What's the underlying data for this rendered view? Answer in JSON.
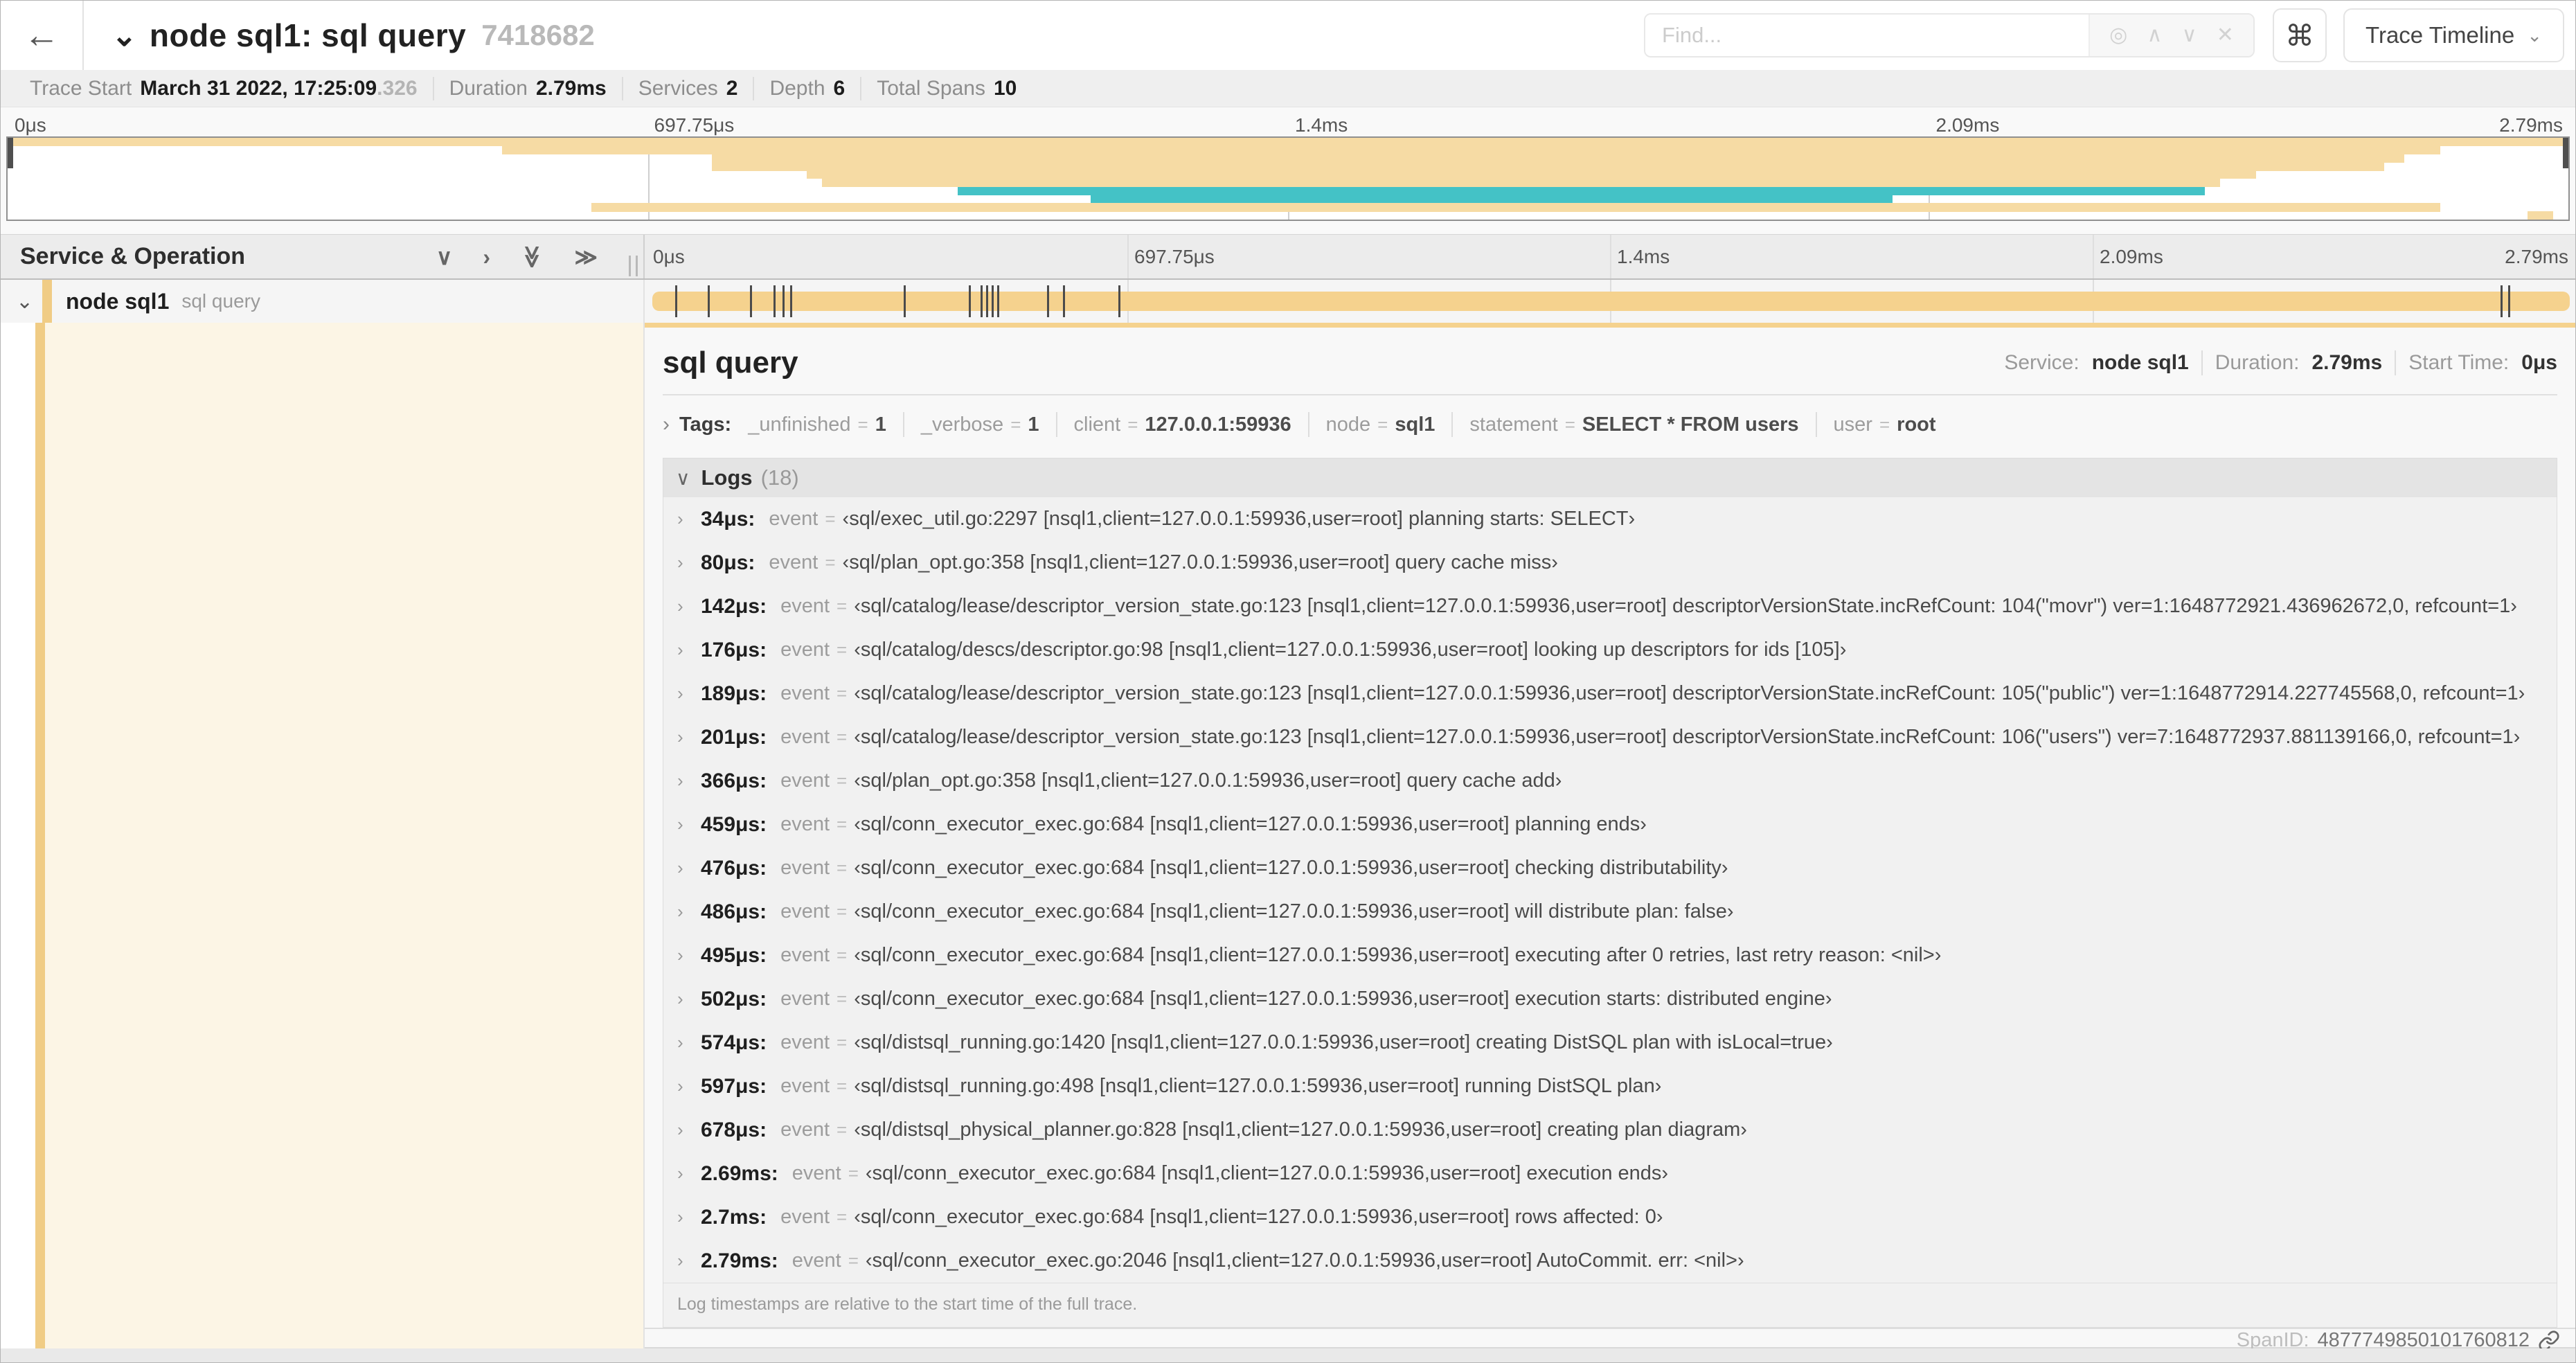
{
  "header": {
    "title": "node sql1: sql query",
    "trace_id": "7418682",
    "find_placeholder": "Find...",
    "command_key": "⌘",
    "view_button": "Trace Timeline",
    "icons": {
      "back": "←",
      "title_collapse": "⌄",
      "locate": "◎",
      "prev": "∧",
      "next": "∨",
      "clear": "✕",
      "view_caret": "⌄"
    }
  },
  "summary": {
    "items": [
      {
        "label": "Trace Start",
        "value": "March 31 2022, 17:25:09",
        "suffix": ".326"
      },
      {
        "label": "Duration",
        "value": "2.79ms",
        "suffix": ""
      },
      {
        "label": "Services",
        "value": "2",
        "suffix": ""
      },
      {
        "label": "Depth",
        "value": "6",
        "suffix": ""
      },
      {
        "label": "Total Spans",
        "value": "10",
        "suffix": ""
      }
    ]
  },
  "timeline": {
    "left_header": "Service & Operation",
    "ticks": [
      "0μs",
      "697.75μs",
      "1.4ms",
      "2.09ms",
      "2.79ms"
    ],
    "icons": {
      "collapse_one": "∨",
      "expand_one": "›",
      "collapse_all": "≫",
      "expand_all": "≫"
    }
  },
  "span": {
    "service": "node sql1",
    "operation": "sql query",
    "chevron": "⌄"
  },
  "detail": {
    "title": "sql query",
    "service_label": "Service:",
    "service_value": "node sql1",
    "duration_label": "Duration:",
    "duration_value": "2.79ms",
    "start_label": "Start Time:",
    "start_value": "0μs",
    "tags_label": "Tags:",
    "eq_sign": "=",
    "tags": [
      {
        "key": "_unfinished",
        "value": "1"
      },
      {
        "key": "_verbose",
        "value": "1"
      },
      {
        "key": "client",
        "value": "127.0.0.1:59936"
      },
      {
        "key": "node",
        "value": "sql1"
      },
      {
        "key": "statement",
        "value": "SELECT * FROM users"
      },
      {
        "key": "user",
        "value": "root"
      }
    ],
    "logs_label": "Logs",
    "logs_count": "(18)",
    "logs": [
      {
        "time": "34μs:",
        "key": "event",
        "value": "‹sql/exec_util.go:2297 [nsql1,client=127.0.0.1:59936,user=root] planning starts: SELECT›"
      },
      {
        "time": "80μs:",
        "key": "event",
        "value": "‹sql/plan_opt.go:358 [nsql1,client=127.0.0.1:59936,user=root] query cache miss›"
      },
      {
        "time": "142μs:",
        "key": "event",
        "value": "‹sql/catalog/lease/descriptor_version_state.go:123 [nsql1,client=127.0.0.1:59936,user=root] descriptorVersionState.incRefCount: 104(\"movr\") ver=1:1648772921.436962672,0, refcount=1›"
      },
      {
        "time": "176μs:",
        "key": "event",
        "value": "‹sql/catalog/descs/descriptor.go:98 [nsql1,client=127.0.0.1:59936,user=root] looking up descriptors for ids [105]›"
      },
      {
        "time": "189μs:",
        "key": "event",
        "value": "‹sql/catalog/lease/descriptor_version_state.go:123 [nsql1,client=127.0.0.1:59936,user=root] descriptorVersionState.incRefCount: 105(\"public\") ver=1:1648772914.227745568,0, refcount=1›"
      },
      {
        "time": "201μs:",
        "key": "event",
        "value": "‹sql/catalog/lease/descriptor_version_state.go:123 [nsql1,client=127.0.0.1:59936,user=root] descriptorVersionState.incRefCount: 106(\"users\") ver=7:1648772937.881139166,0, refcount=1›"
      },
      {
        "time": "366μs:",
        "key": "event",
        "value": "‹sql/plan_opt.go:358 [nsql1,client=127.0.0.1:59936,user=root] query cache add›"
      },
      {
        "time": "459μs:",
        "key": "event",
        "value": "‹sql/conn_executor_exec.go:684 [nsql1,client=127.0.0.1:59936,user=root] planning ends›"
      },
      {
        "time": "476μs:",
        "key": "event",
        "value": "‹sql/conn_executor_exec.go:684 [nsql1,client=127.0.0.1:59936,user=root] checking distributability›"
      },
      {
        "time": "486μs:",
        "key": "event",
        "value": "‹sql/conn_executor_exec.go:684 [nsql1,client=127.0.0.1:59936,user=root] will distribute plan: false›"
      },
      {
        "time": "495μs:",
        "key": "event",
        "value": "‹sql/conn_executor_exec.go:684 [nsql1,client=127.0.0.1:59936,user=root] executing after 0 retries, last retry reason: <nil>›"
      },
      {
        "time": "502μs:",
        "key": "event",
        "value": "‹sql/conn_executor_exec.go:684 [nsql1,client=127.0.0.1:59936,user=root] execution starts: distributed engine›"
      },
      {
        "time": "574μs:",
        "key": "event",
        "value": "‹sql/distsql_running.go:1420 [nsql1,client=127.0.0.1:59936,user=root] creating DistSQL plan with isLocal=true›"
      },
      {
        "time": "597μs:",
        "key": "event",
        "value": "‹sql/distsql_running.go:498 [nsql1,client=127.0.0.1:59936,user=root] running DistSQL plan›"
      },
      {
        "time": "678μs:",
        "key": "event",
        "value": "‹sql/distsql_physical_planner.go:828 [nsql1,client=127.0.0.1:59936,user=root] creating plan diagram›"
      },
      {
        "time": "2.69ms:",
        "key": "event",
        "value": "‹sql/conn_executor_exec.go:684 [nsql1,client=127.0.0.1:59936,user=root] execution ends›"
      },
      {
        "time": "2.7ms:",
        "key": "event",
        "value": "‹sql/conn_executor_exec.go:684 [nsql1,client=127.0.0.1:59936,user=root] rows affected: 0›"
      },
      {
        "time": "2.79ms:",
        "key": "event",
        "value": "‹sql/conn_executor_exec.go:2046 [nsql1,client=127.0.0.1:59936,user=root] AutoCommit. err: <nil>›"
      }
    ],
    "note": "Log timestamps are relative to the start time of the full trace.",
    "span_id_label": "SpanID:",
    "span_id": "4877749850101760812"
  },
  "chart_data": {
    "type": "gantt-minimap",
    "title": "trace span waterfall",
    "duration_label": "2.79ms",
    "axis_ticks": [
      "0μs",
      "697.75μs",
      "1.4ms",
      "2.09ms",
      "2.79ms"
    ],
    "grid_fractions": [
      0.25,
      0.5,
      0.75
    ],
    "colors": {
      "tan": "#F6DBA4",
      "bar_tan": "#F5D28E",
      "teal": "#44C2C6",
      "tint": "#FCF5E5",
      "strip": "#F0CC85"
    },
    "minimap_rows": [
      {
        "s": 0.0,
        "e": 1.0,
        "c": "tan"
      },
      {
        "s": 0.193,
        "e": 0.95,
        "c": "tan"
      },
      {
        "s": 0.275,
        "e": 0.936,
        "c": "tan"
      },
      {
        "s": 0.275,
        "e": 0.928,
        "c": "tan"
      },
      {
        "s": 0.312,
        "e": 0.878,
        "c": "tan"
      },
      {
        "s": 0.318,
        "e": 0.864,
        "c": "tan"
      },
      {
        "s": 0.371,
        "e": 0.858,
        "c": "teal"
      },
      {
        "s": 0.423,
        "e": 0.736,
        "c": "teal"
      },
      {
        "s": 0.228,
        "e": 0.95,
        "c": "tan"
      },
      {
        "s": 0.984,
        "e": 0.994,
        "c": "tan"
      }
    ],
    "span_bar": {
      "start": 0,
      "end": 1,
      "log_marks": [
        0.012,
        0.029,
        0.051,
        0.063,
        0.068,
        0.072,
        0.131,
        0.165,
        0.171,
        0.174,
        0.177,
        0.18,
        0.206,
        0.214,
        0.243,
        0.964,
        0.968
      ]
    }
  }
}
